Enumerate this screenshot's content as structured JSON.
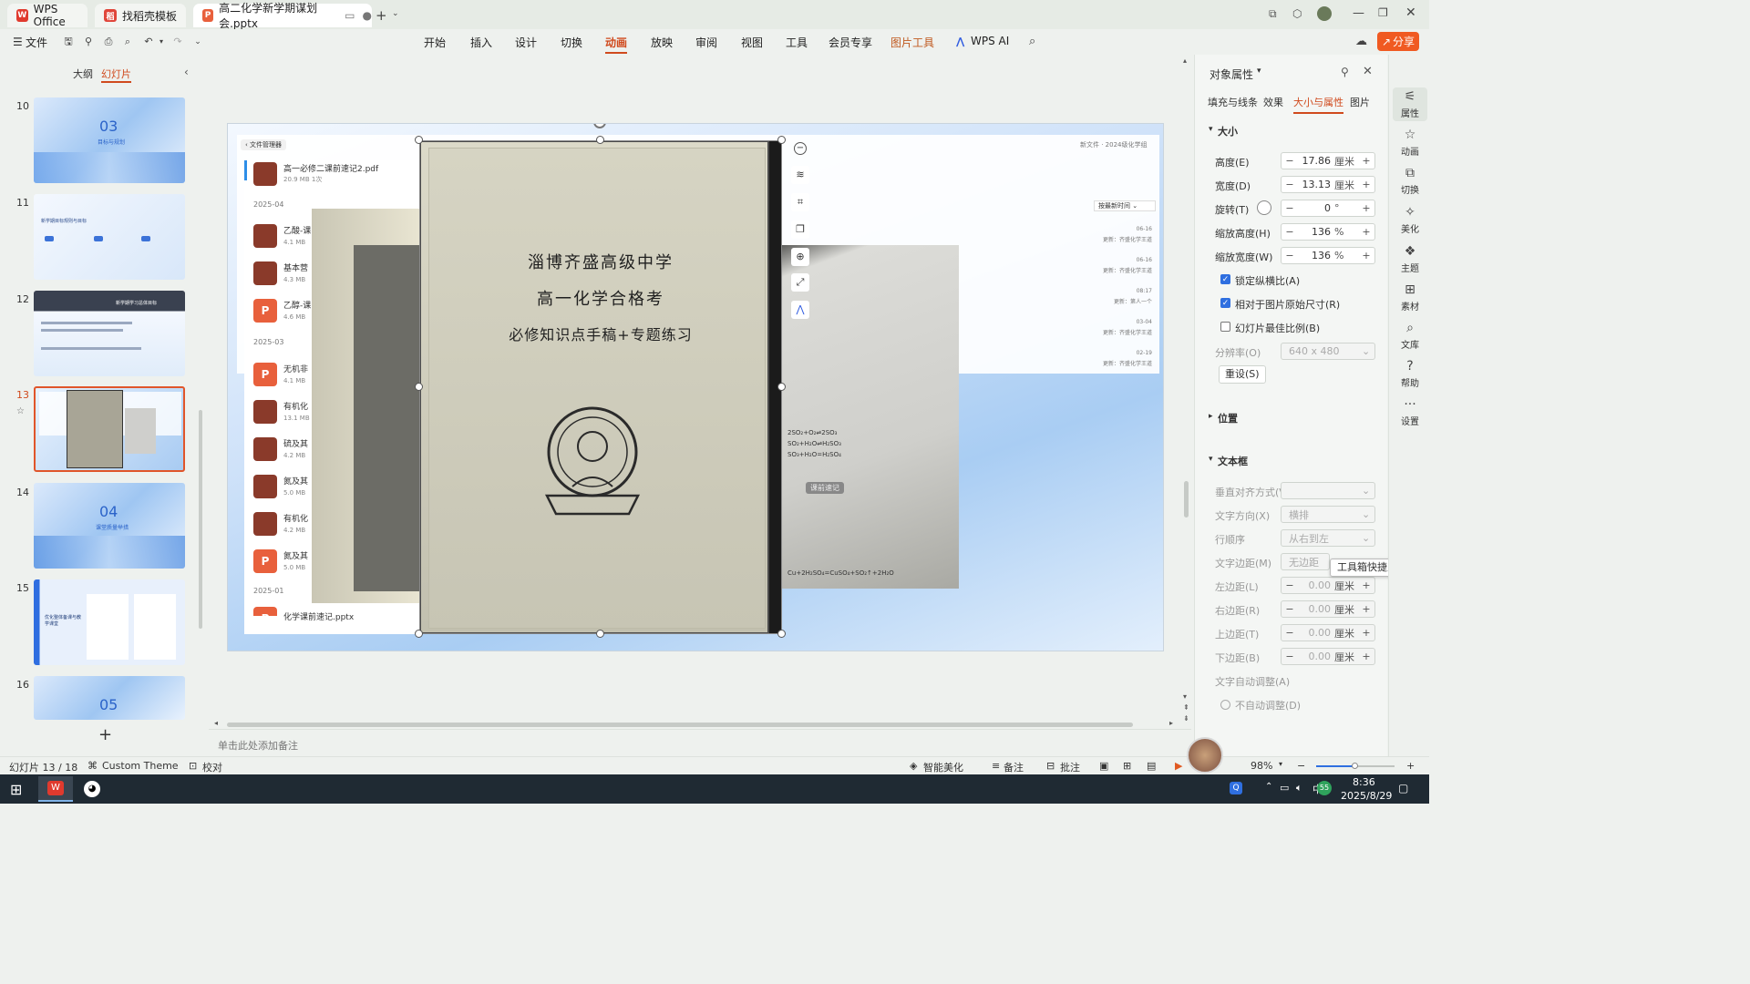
{
  "tabs": [
    {
      "label": "WPS Office",
      "icon": "wps-logo-icon"
    },
    {
      "label": "找稻壳模板",
      "icon": "docer-icon"
    },
    {
      "label": "高二化学新学期谋划会.pptx",
      "icon": "pptx-file-icon"
    }
  ],
  "menu": [
    "文件",
    "开始",
    "插入",
    "设计",
    "切换",
    "动画",
    "放映",
    "审阅",
    "视图",
    "工具",
    "会员专享",
    "图片工具",
    "WPS AI"
  ],
  "active_menu": "动画",
  "share_label": "分享",
  "left_panel": {
    "tab_outline": "大纲",
    "tab_slides": "幻灯片",
    "slides": [
      {
        "num": "10",
        "title": "03",
        "subtitle": "目标与规划"
      },
      {
        "num": "11",
        "title": "新学期目标规则与目标"
      },
      {
        "num": "12",
        "title": "新学期学习总体目标"
      },
      {
        "num": "13",
        "title": ""
      },
      {
        "num": "14",
        "title": "04",
        "subtitle": "课堂质量举措"
      },
      {
        "num": "15",
        "title": "优化整体备课与教学课堂"
      },
      {
        "num": "16",
        "title": "05"
      }
    ],
    "add_label": "+"
  },
  "slide": {
    "file_manager_label": "文件管理器",
    "breadcrumb": "新文件 · 2024级化学组",
    "sort_label": "按最新时间",
    "files": [
      {
        "name": "高一必修二课前速记2.pdf",
        "meta": "20.9 MB  1次"
      },
      {
        "name": "乙酸-课",
        "meta": "4.1 MB"
      },
      {
        "name": "基本营",
        "meta": "4.3 MB"
      },
      {
        "name": "乙醇-课",
        "meta": "4.6 MB"
      },
      {
        "name": "无机非",
        "meta": "4.1 MB"
      },
      {
        "name": "有机化",
        "meta": "13.1 MB"
      },
      {
        "name": "硫及其",
        "meta": "4.2 MB"
      },
      {
        "name": "氮及其",
        "meta": "5.0 MB"
      },
      {
        "name": "有机化",
        "meta": "4.2 MB"
      },
      {
        "name": "氮及其",
        "meta": "5.0 MB"
      },
      {
        "name": "化学课前速记.pptx",
        "meta": ""
      }
    ],
    "date_groups": [
      "2025-04",
      "2025-03",
      "2025-01"
    ],
    "right_rows": [
      {
        "date": "06-16",
        "who": "更新：齐盛化学王道"
      },
      {
        "date": "06-16",
        "who": "更新：齐盛化学王道"
      },
      {
        "date": "08:17",
        "who": "更新：第人一个"
      },
      {
        "date": "03-04",
        "who": "更新：齐盛化学王道"
      },
      {
        "date": "02-19",
        "who": "更新：齐盛化学王道"
      }
    ],
    "book_lines": [
      "淄博齐盛高级中学",
      "高一化学合格考",
      "必修知识点手稿+专题练习"
    ],
    "handout_snippets": [
      "课前速记",
      "2SO₂+O₂⇌2SO₃",
      "SO₂+H₂O⇌H₂SO₃",
      "SO₃+H₂O=H₂SO₄",
      "Cu+2H₂SO₄=CuSO₄+SO₂↑+2H₂O"
    ]
  },
  "notes_placeholder": "单击此处添加备注",
  "properties": {
    "title": "对象属性",
    "tabs": [
      "填充与线条",
      "效果",
      "大小与属性",
      "图片"
    ],
    "active_tab": "大小与属性",
    "section_size": "大小",
    "height_label": "高度(E)",
    "height_value": "17.86",
    "unit_cm": "厘米",
    "width_label": "宽度(D)",
    "width_value": "13.13",
    "rotate_label": "旋转(T)",
    "rotate_value": "0",
    "unit_deg": "°",
    "scale_h_label": "缩放高度(H)",
    "scale_h_value": "136",
    "unit_pct": "%",
    "scale_w_label": "缩放宽度(W)",
    "scale_w_value": "136",
    "lock_ratio": "锁定纵横比(A)",
    "relative_orig": "相对于图片原始尺寸(R)",
    "best_scale": "幻灯片最佳比例(B)",
    "resolution_label": "分辨率(O)",
    "resolution_value": "640 x 480",
    "reset_label": "重设(S)",
    "section_position": "位置",
    "section_textbox": "文本框",
    "valign_label": "垂直对齐方式(V)",
    "text_dir_label": "文字方向(X)",
    "text_dir_value": "横排",
    "line_order_label": "行顺序",
    "line_order_value": "从右到左",
    "margin_label": "文字边距(M)",
    "margin_value": "无边距",
    "left_margin": "左边距(L)",
    "right_margin": "右边距(R)",
    "top_margin": "上边距(T)",
    "bottom_margin": "下边距(B)",
    "margin_zero": "0.00",
    "auto_adjust_label": "文字自动调整(A)",
    "no_auto": "不自动调整(D)",
    "tooltip": "工具箱快捷入口"
  },
  "side_strip": [
    "属性",
    "动画",
    "切换",
    "美化",
    "主题",
    "素材",
    "文库",
    "帮助",
    "设置"
  ],
  "status": {
    "slide_count": "幻灯片 13 / 18",
    "theme": "Custom Theme",
    "proofread": "校对",
    "beautify": "智能美化",
    "notes": "备注",
    "comment": "批注",
    "zoom": "98%"
  },
  "taskbar": {
    "time": "8:36",
    "date": "2025/8/29",
    "badge": "55"
  }
}
